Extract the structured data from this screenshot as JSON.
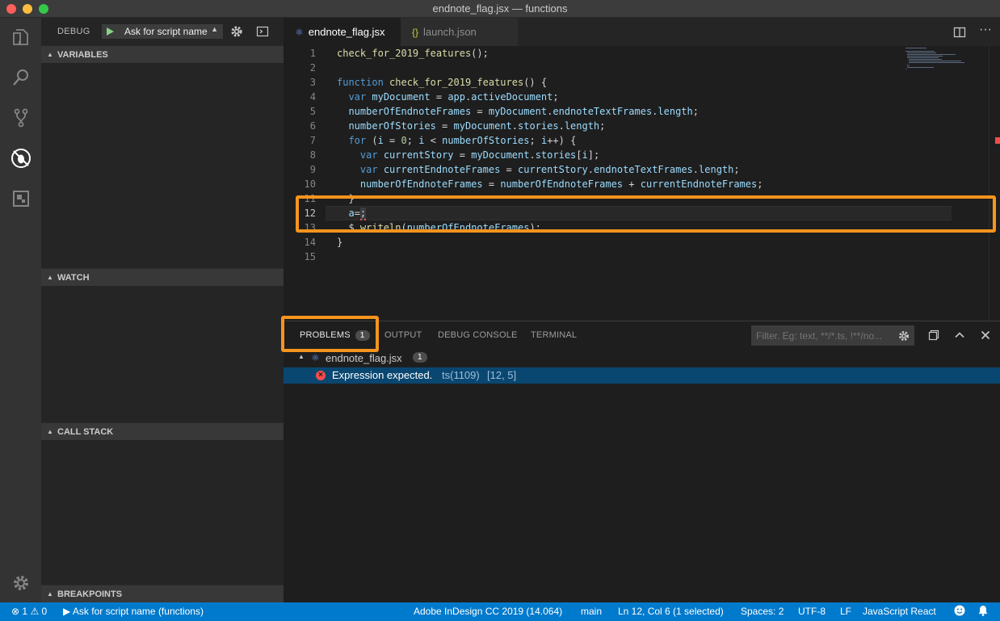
{
  "window": {
    "title": "endnote_flag.jsx — functions"
  },
  "activity_bar": {
    "items": [
      "explorer-icon",
      "search-icon",
      "source-control-icon",
      "debug-icon",
      "extensions-icon"
    ],
    "manage": "gear-icon"
  },
  "debug": {
    "label": "DEBUG",
    "config_selected": "Ask for script name"
  },
  "sidebar": {
    "sections": [
      "VARIABLES",
      "WATCH",
      "CALL STACK",
      "BREAKPOINTS"
    ]
  },
  "tabs": [
    {
      "label": "endnote_flag.jsx",
      "active": true
    },
    {
      "label": "launch.json",
      "active": false
    }
  ],
  "editor": {
    "line_numbers": [
      "1",
      "2",
      "3",
      "4",
      "5",
      "6",
      "7",
      "8",
      "9",
      "10",
      "11",
      "12",
      "13",
      "14",
      "15"
    ],
    "lines": [
      "check_for_2019_features();",
      "",
      "function check_for_2019_features() {",
      "  var myDocument = app.activeDocument;",
      "  numberOfEndnoteFrames = myDocument.endnoteTextFrames.length;",
      "  numberOfStories = myDocument.stories.length;",
      "  for (i = 0; i < numberOfStories; i++) {",
      "    var currentStory = myDocument.stories[i];",
      "    var currentEndnoteFrames = currentStory.endnoteTextFrames.length;",
      "    numberOfEndnoteFrames = numberOfEndnoteFrames + currentEndnoteFrames;",
      "  }",
      "  a=;",
      "  $.writeln(numberOfEndnoteFrames);",
      "}",
      ""
    ],
    "current_line": 12
  },
  "panel": {
    "tabs": [
      "PROBLEMS",
      "OUTPUT",
      "DEBUG CONSOLE",
      "TERMINAL"
    ],
    "problem_count": "1",
    "filter_placeholder": "Filter. Eg: text, **/*.ts, !**/no...",
    "file": "endnote_flag.jsx",
    "file_count": "1",
    "problem": {
      "message": "Expression expected.",
      "code": "ts(1109)",
      "position": "[12, 5]"
    }
  },
  "status_bar": {
    "errors": "1",
    "warnings": "0",
    "debug_config": "Ask for script name (functions)",
    "target": "Adobe InDesign CC 2019 (14.064)",
    "engine": "main",
    "cursor": "Ln 12, Col 6 (1 selected)",
    "spaces": "Spaces: 2",
    "encoding": "UTF-8",
    "eol": "LF",
    "language": "JavaScript React"
  },
  "colors": {
    "accent": "#007acc",
    "highlight_box": "#f7941d",
    "error": "#f14c4c"
  }
}
